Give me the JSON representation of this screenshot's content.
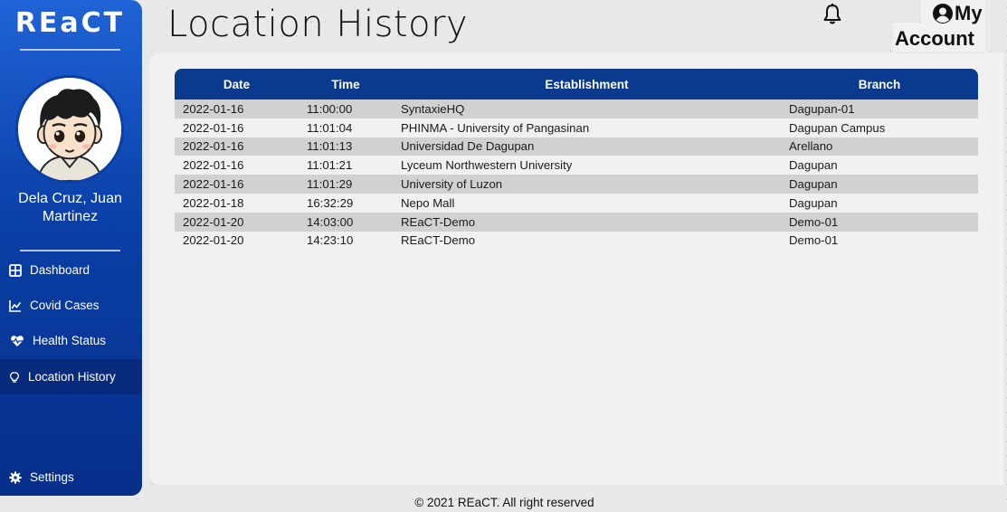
{
  "app": {
    "brand": "REaCT"
  },
  "profile": {
    "name_line1": "Dela Cruz, Juan",
    "name_line2": "Martinez"
  },
  "sidebar": {
    "items": [
      {
        "label": "Dashboard",
        "icon": "dashboard-grid-icon"
      },
      {
        "label": "Covid Cases",
        "icon": "line-chart-icon"
      },
      {
        "label": "Health Status",
        "icon": "heartbeat-icon"
      },
      {
        "label": "Location History",
        "icon": "lightbulb-icon",
        "active": true
      }
    ],
    "settings": {
      "label": "Settings",
      "icon": "gear-icon"
    }
  },
  "header": {
    "title": "Location History",
    "notification_icon": "bell-icon",
    "account": {
      "line1": "My",
      "line2": "Account",
      "icon": "user-circle-icon"
    }
  },
  "table": {
    "columns": [
      "Date",
      "Time",
      "Establishment",
      "Branch"
    ],
    "rows": [
      [
        "2022-01-16",
        "11:00:00",
        "SyntaxieHQ",
        "Dagupan-01"
      ],
      [
        "2022-01-16",
        "11:01:04",
        "PHINMA - University of Pangasinan",
        "Dagupan Campus"
      ],
      [
        "2022-01-16",
        "11:01:13",
        "Universidad De Dagupan",
        "Arellano"
      ],
      [
        "2022-01-16",
        "11:01:21",
        "Lyceum Northwestern University",
        "Dagupan"
      ],
      [
        "2022-01-16",
        "11:01:29",
        "University of Luzon",
        "Dagupan"
      ],
      [
        "2022-01-18",
        "16:32:29",
        "Nepo Mall",
        "Dagupan"
      ],
      [
        "2022-01-20",
        "14:03:00",
        "REaCT-Demo",
        "Demo-01"
      ],
      [
        "2022-01-20",
        "14:23:10",
        "REaCT-Demo",
        "Demo-01"
      ]
    ]
  },
  "footer": {
    "text": "© 2021 REaCT. All right reserved"
  },
  "colors": {
    "sidebar": "#0a3fa6",
    "table_header": "#0a3a8e",
    "row_stripe": "#d1d1d1"
  }
}
